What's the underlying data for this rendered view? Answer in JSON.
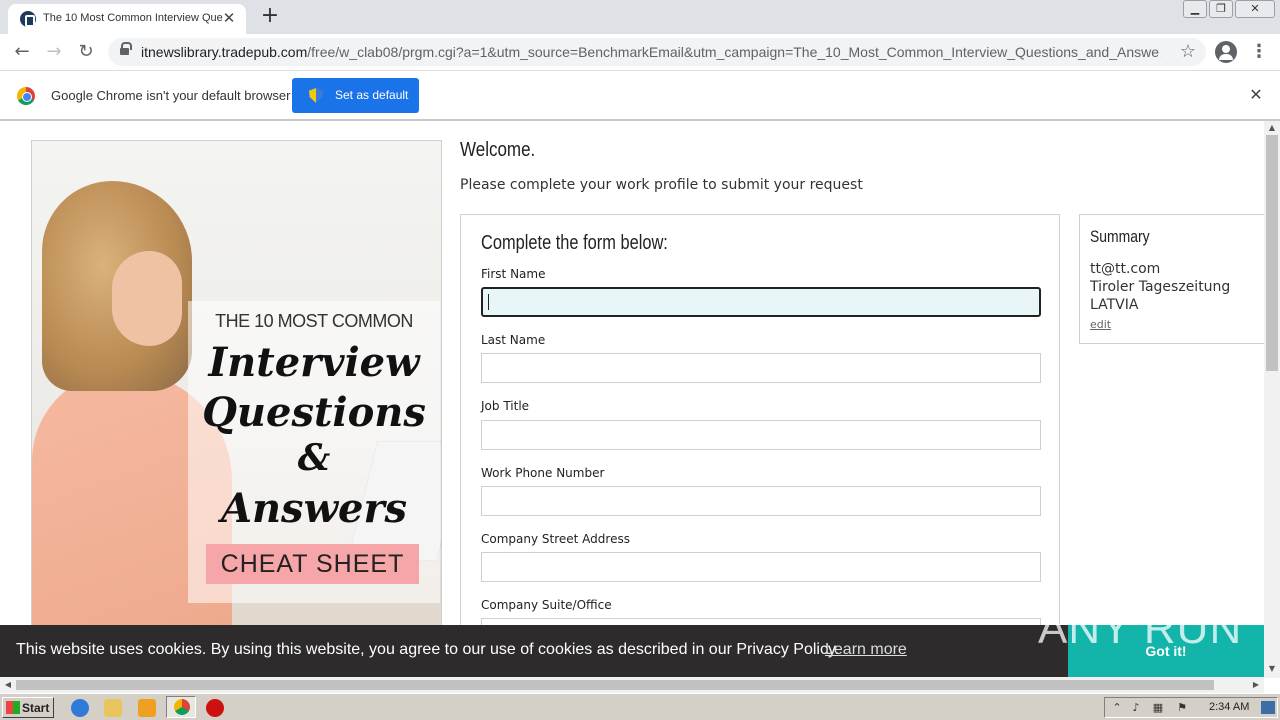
{
  "browser": {
    "tab_title": "The 10 Most Common Interview Que",
    "tab_close": "✕",
    "new_tab": "+",
    "url_host": "itnewslibrary.tradepub.com",
    "url_path": "/free/w_clab08/prgm.cgi?a=1&utm_source=BenchmarkEmail&utm_campaign=The_10_Most_Common_Interview_Questions_and_Answe…",
    "window_controls": [
      "▁",
      "❐",
      "✕"
    ]
  },
  "infobar": {
    "message": "Google Chrome isn't your default browser",
    "button_label": "Set as default",
    "close": "✕"
  },
  "cover": {
    "top_line": "THE 10 MOST COMMON",
    "script_lines": [
      "Interview",
      "Questions",
      "&",
      "Answers"
    ],
    "banner": "CHEAT SHEET"
  },
  "page": {
    "welcome": "Welcome.",
    "subtitle": "Please complete your work profile to submit your request"
  },
  "form": {
    "title": "Complete the form below:",
    "fields": [
      {
        "label": "First Name",
        "value": ""
      },
      {
        "label": "Last Name",
        "value": ""
      },
      {
        "label": "Job Title",
        "value": ""
      },
      {
        "label": "Work Phone Number",
        "value": ""
      },
      {
        "label": "Company Street Address",
        "value": ""
      },
      {
        "label": "Company Suite/Office",
        "value": ""
      }
    ]
  },
  "summary": {
    "title": "Summary",
    "email": "tt@tt.com",
    "company": "Tiroler Tageszeitung",
    "country": "LATVIA",
    "edit": "edit"
  },
  "cookie": {
    "message": "This website uses cookies. By using this website, you agree to our use of cookies as described in our Privacy Policy.",
    "learn_more": "Learn more",
    "button": "Got it!"
  },
  "watermark": "ANY RUN",
  "taskbar": {
    "start": "Start",
    "clock": "2:34 AM"
  },
  "colors": {
    "accent_blue": "#1a73e8",
    "cookie_bg": "#2d2b2b",
    "cookie_button": "#13b5aa",
    "cheat_banner": "#f6a6a8",
    "focused_input": "#e8f6f8"
  }
}
